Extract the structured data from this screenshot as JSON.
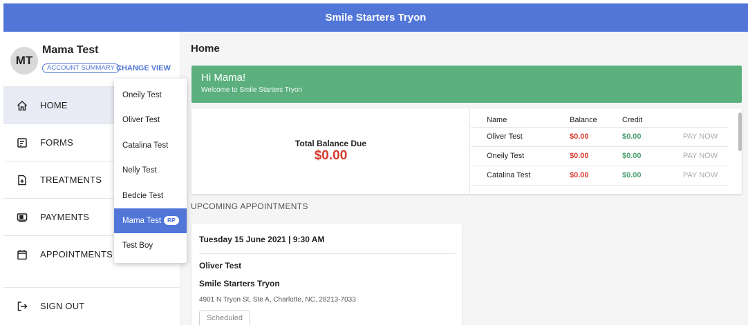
{
  "header": {
    "title": "Smile Starters Tryon"
  },
  "user": {
    "initials": "MT",
    "name": "Mama Test",
    "account_summary_label": "ACCOUNT SUMMARY",
    "change_view_label": "CHANGE VIEW"
  },
  "nav": {
    "items": [
      {
        "label": "HOME",
        "icon": "home-icon",
        "active": true
      },
      {
        "label": "FORMS",
        "icon": "forms-icon",
        "active": false
      },
      {
        "label": "TREATMENTS",
        "icon": "treatments-icon",
        "active": false
      },
      {
        "label": "PAYMENTS",
        "icon": "payments-icon",
        "active": false
      },
      {
        "label": "APPOINTMENTS",
        "icon": "calendar-icon",
        "active": false
      }
    ],
    "signout_label": "SIGN OUT"
  },
  "dropdown": {
    "items": [
      "Oneily Test",
      "Oliver Test",
      "Catalina Test",
      "Nelly Test",
      "Bedcie Test",
      "Mama Test",
      "Test Boy"
    ],
    "selected": "Mama Test",
    "selected_badge": "RP"
  },
  "main": {
    "page_title": "Home",
    "welcome_title": "Hi Mama!",
    "welcome_subtitle": "Welcome to Smile Starters Tryon",
    "total_balance_label": "Total Balance Due",
    "total_balance_amount": "$0.00",
    "balance_table": {
      "headers": {
        "name": "Name",
        "balance": "Balance",
        "credit": "Credit"
      },
      "rows": [
        {
          "name": "Oliver Test",
          "balance": "$0.00",
          "credit": "$0.00",
          "action": "PAY NOW"
        },
        {
          "name": "Oneily Test",
          "balance": "$0.00",
          "credit": "$0.00",
          "action": "PAY NOW"
        },
        {
          "name": "Catalina Test",
          "balance": "$0.00",
          "credit": "$0.00",
          "action": "PAY NOW"
        }
      ]
    },
    "upcoming_title": "UPCOMING APPOINTMENTS",
    "appointment": {
      "datetime": "Tuesday 15 June 2021 | 9:30 AM",
      "patient": "Oliver Test",
      "clinic": "Smile Starters Tryon",
      "address": "4901 N Tryon St, Ste A, Charlotte, NC, 28213-7033",
      "status": "Scheduled"
    }
  },
  "colors": {
    "primary": "#5176d8",
    "welcome_green": "#5bb07e",
    "balance_red": "#d63b2f",
    "credit_green": "#4aa06c"
  }
}
